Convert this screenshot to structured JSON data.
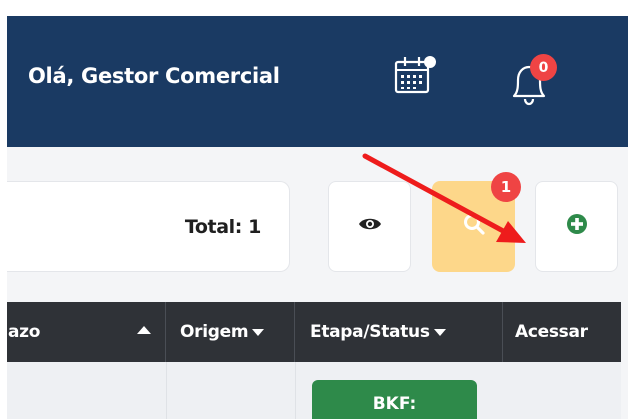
{
  "header": {
    "greeting": "Olá, Gestor Comercial",
    "calendar_icon": "calendar-icon",
    "bell_icon": "bell-icon",
    "notification_count": "0",
    "background": "#1a3a63"
  },
  "toolbar": {
    "total_label": "Total: 1",
    "view_icon": "eye-icon",
    "search_icon": "search-icon",
    "search_badge": "1",
    "add_icon": "plus-circle-icon",
    "search_button_color": "#fdd78a",
    "add_icon_color": "#2e8a4a"
  },
  "table": {
    "columns": [
      {
        "label": "azo",
        "sort": "asc"
      },
      {
        "label": "Origem"
      },
      {
        "label": "Etapa/Status"
      },
      {
        "label": "Acessar"
      }
    ],
    "rows": [
      {
        "status": "BKF:",
        "status_color": "#2e8a4a"
      }
    ]
  },
  "annotation": {
    "arrow_color": "#ee1c1c"
  }
}
